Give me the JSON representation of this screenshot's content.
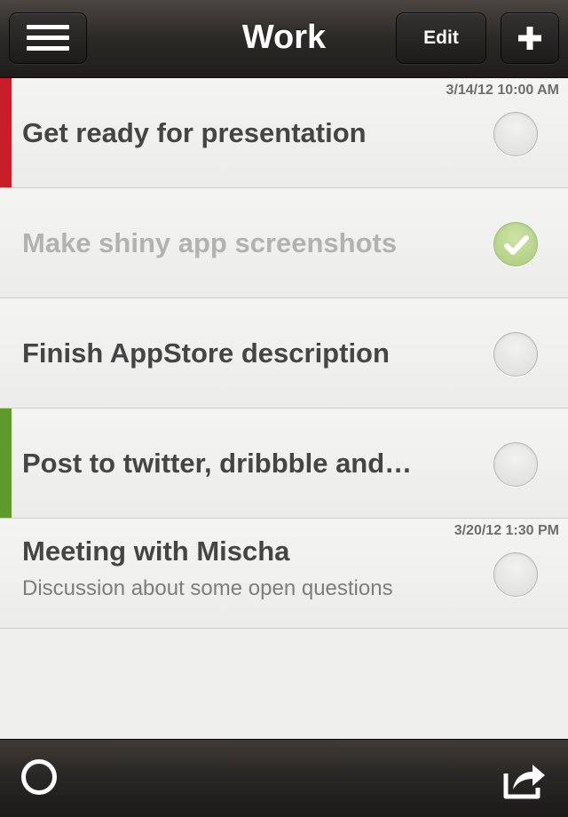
{
  "header": {
    "title": "Work",
    "edit_label": "Edit",
    "menu_icon": "hamburger-menu-icon",
    "add_icon": "plus-icon"
  },
  "tasks": [
    {
      "title": "Get ready for presentation",
      "date": "3/14/12 10:00 AM",
      "subtitle": "",
      "done": false,
      "priority_color": "#c81e2a"
    },
    {
      "title": "Make shiny app screenshots",
      "date": "",
      "subtitle": "",
      "done": true,
      "priority_color": ""
    },
    {
      "title": "Finish AppStore description",
      "date": "",
      "subtitle": "",
      "done": false,
      "priority_color": ""
    },
    {
      "title": "Post to twitter, dribbble and…",
      "date": "",
      "subtitle": "",
      "done": false,
      "priority_color": "#5f9a2c"
    },
    {
      "title": "Meeting with Mischa",
      "date": "3/20/12 1:30 PM",
      "subtitle": "Discussion about some open questions",
      "done": false,
      "priority_color": ""
    }
  ],
  "footer": {
    "left_icon": "circle-icon",
    "right_icon": "share-icon"
  },
  "colors": {
    "priority_red": "#c81e2a",
    "priority_green": "#5f9a2c",
    "done_check": "#a9cc7a"
  }
}
